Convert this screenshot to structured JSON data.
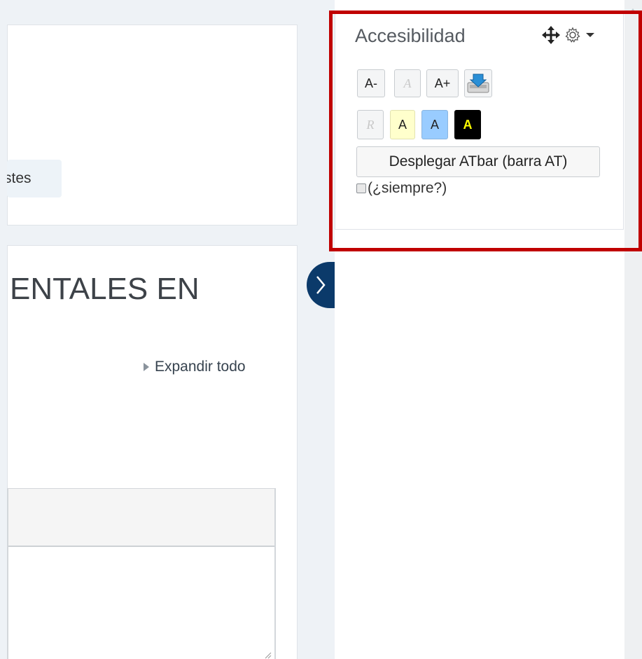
{
  "left": {
    "pill_button_text": "stes",
    "course_title": "ENTALES EN",
    "expand_all": "Expandir todo"
  },
  "drawer": {
    "toggle_icon": "chevron-right-icon"
  },
  "block": {
    "title": "Accesibilidad",
    "controls": {
      "move_icon": "move-icon",
      "settings_icon": "gear-icon",
      "menu_icon": "caret-down-icon"
    },
    "font_buttons": {
      "decrease": "A-",
      "reset": "A",
      "increase": "A+",
      "save_icon": "save-icon"
    },
    "color_buttons": {
      "reset": "R",
      "yellow": "A",
      "blue": "A",
      "black": "A"
    },
    "atbar_button": "Desplegar ATbar (barra AT)",
    "always_label": "(¿siempre?)"
  },
  "colors": {
    "highlight": "#c00000",
    "drawer_toggle": "#0b3a6a",
    "yellow_bg": "#ffffcc",
    "blue_bg": "#99ccff",
    "black_bg": "#000000",
    "black_text": "#ffff00"
  }
}
